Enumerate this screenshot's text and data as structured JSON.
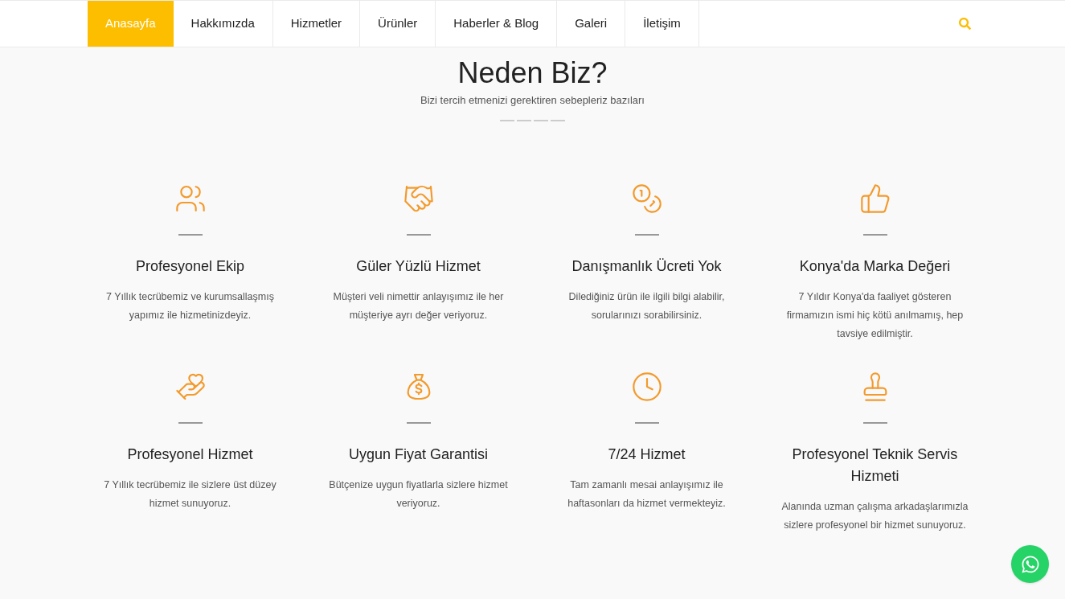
{
  "nav": {
    "items": [
      {
        "label": "Anasayfa",
        "selected": true
      },
      {
        "label": "Hakkımızda",
        "selected": false
      },
      {
        "label": "Hizmetler",
        "selected": false
      },
      {
        "label": "Ürünler",
        "selected": false
      },
      {
        "label": "Haberler & Blog",
        "selected": false
      },
      {
        "label": "Galeri",
        "selected": false
      },
      {
        "label": "İletişim",
        "selected": false
      }
    ]
  },
  "section": {
    "title": "Neden Biz?",
    "subtitle": "Bizi tercih etmenizi gerektiren sebepleriz bazıları",
    "features": [
      {
        "title": "Profesyonel Ekip",
        "text": "7 Yıllık tecrübemiz ve kurumsallaşmış yapımız ile hizmetinizdeyiz."
      },
      {
        "title": "Güler Yüzlü Hizmet",
        "text": "Müşteri veli nimettir anlayışımız ile her müşteriye ayrı değer veriyoruz."
      },
      {
        "title": "Danışmanlık Ücreti Yok",
        "text": "Dilediğiniz ürün ile ilgili bilgi alabilir, sorularınızı sorabilirsiniz."
      },
      {
        "title": "Konya'da Marka Değeri",
        "text": "7 Yıldır Konya'da faaliyet gösteren firmamızın ismi hiç kötü anılmamış, hep tavsiye edilmiştir."
      },
      {
        "title": "Profesyonel Hizmet",
        "text": "7 Yıllık tecrübemiz ile sizlere üst düzey hizmet sunuyoruz."
      },
      {
        "title": "Uygun Fiyat Garantisi",
        "text": "Bütçenize uygun fiyatlarla sizlere hizmet veriyoruz."
      },
      {
        "title": "7/24 Hizmet",
        "text": "Tam zamanlı mesai anlayışımız ile haftasonları da hizmet vermekteyiz."
      },
      {
        "title": "Profesyonel Teknik Servis Hizmeti",
        "text": "Alanında uzman çalışma arkadaşlarımızla sizlere profesyonel bir hizmet sunuyoruz."
      }
    ]
  }
}
